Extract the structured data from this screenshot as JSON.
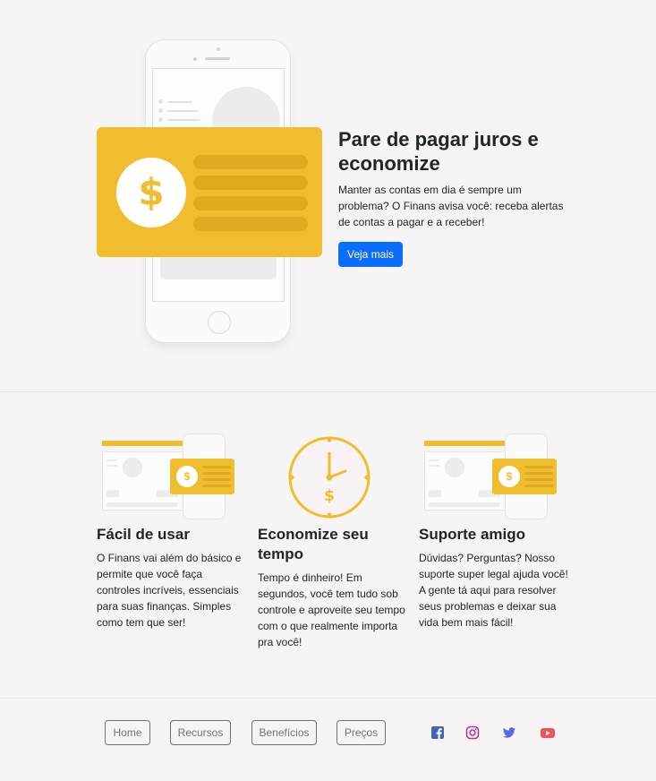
{
  "hero": {
    "title": "Pare de pagar juros e economize",
    "description": "Manter as contas em dia é sempre um problema? O Finans avisa você: receba alertas de contas a pagar e a receber!",
    "button_label": "Veja mais",
    "coin_symbol": "$"
  },
  "features": [
    {
      "title": "Fácil de usar",
      "description": "O Finans vai além do básico e permite que você faça controles incríveis, essenciais para suas finanças. Simples como tem que ser!"
    },
    {
      "title": "Economize seu tempo",
      "description": "Tempo é dinheiro! Em segundos, você tem tudo sob controle e aproveite seu tempo com o que realmente importa pra você!",
      "clock_symbol": "$"
    },
    {
      "title": "Suporte amigo",
      "description": "Dúvidas? Perguntas? Nosso suporte super legal ajuda você! A gente tá aqui para resolver seus problemas e deixar sua vida bem mais fácil!"
    }
  ],
  "footer": {
    "nav": [
      "Home",
      "Recursos",
      "Benefícios",
      "Preços"
    ],
    "social": [
      {
        "icon": "facebook-icon",
        "color": "#4267b2"
      },
      {
        "icon": "instagram-icon",
        "color": "#c13584"
      },
      {
        "icon": "twitter-icon",
        "color": "#5b67e6"
      },
      {
        "icon": "youtube-icon",
        "color": "#e9575b"
      }
    ]
  },
  "colors": {
    "accent": "#f0bd2f",
    "primary": "#0d6efd",
    "background": "#f6f4f5"
  }
}
